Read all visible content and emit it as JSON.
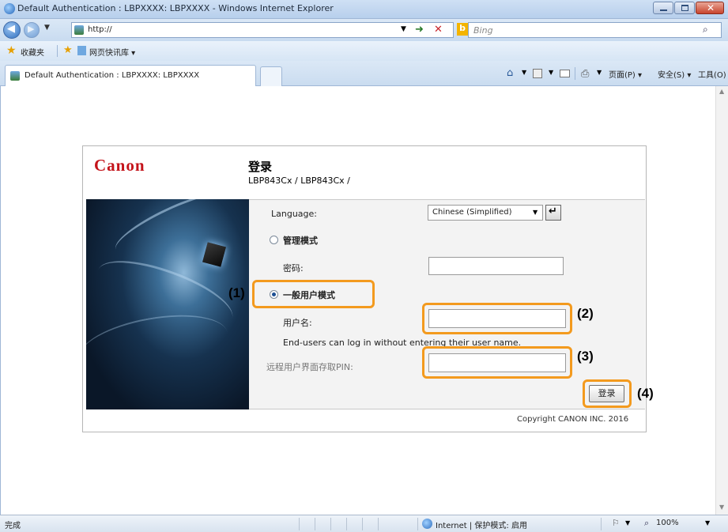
{
  "window": {
    "title": "Default Authentication : LBPXXXX: LBPXXXX - Windows Internet Explorer"
  },
  "addressbar": {
    "url": "http://",
    "search_placeholder": "Bing"
  },
  "favorites": {
    "favorites_label": "收藏夹",
    "web_slice_label": "网页快讯库 ▾"
  },
  "tabs": {
    "active_label": "Default Authentication : LBPXXXX: LBPXXXX"
  },
  "command_bar": {
    "page_menu": "页面(P) ▾",
    "safety_menu": "安全(S) ▾",
    "tools_menu": "工具(O) ▾"
  },
  "page": {
    "logo": "Canon",
    "heading": "登录",
    "model": "LBP843Cx / LBP843Cx /",
    "language_label": "Language:",
    "language_value": "Chinese (Simplified)",
    "admin_mode_label": "管理模式",
    "password_label": "密码:",
    "user_mode_label": "一般用户模式",
    "username_label": "用户名:",
    "end_user_note": "End-users can log in without entering their user name.",
    "pin_label": "远程用户界面存取PIN:",
    "login_button": "登录",
    "copyright": "Copyright CANON INC. 2016"
  },
  "callouts": {
    "c1": "(1)",
    "c2": "(2)",
    "c3": "(3)",
    "c4": "(4)"
  },
  "statusbar": {
    "status_text": "完成",
    "zone_text": "Internet | 保护模式: 启用",
    "zoom": "100%"
  },
  "colors": {
    "canon_red": "#c4141b",
    "callout_orange": "#f39a1e"
  }
}
